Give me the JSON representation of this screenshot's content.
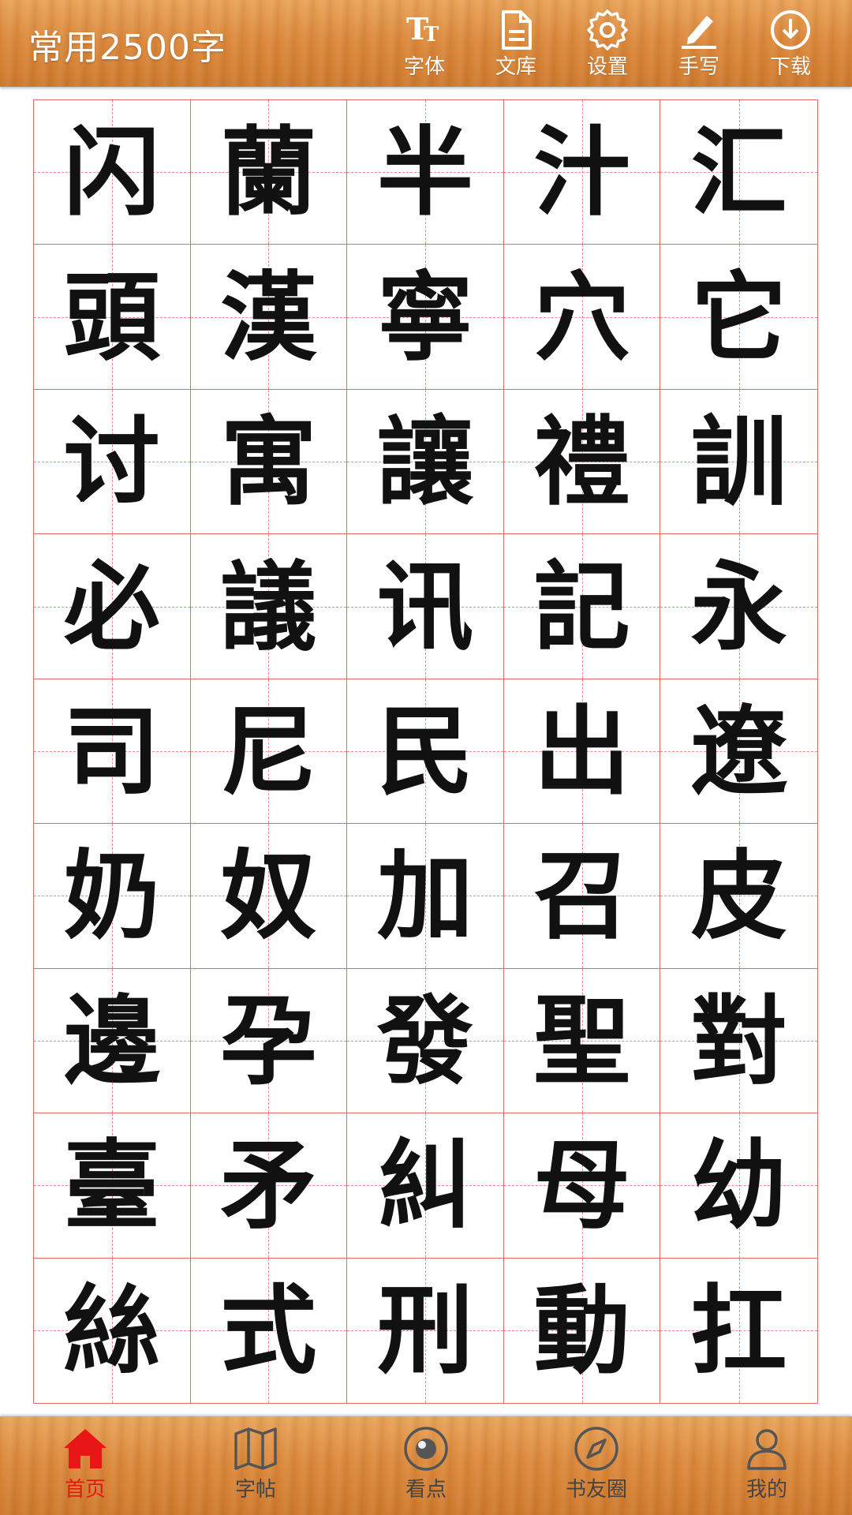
{
  "header": {
    "title": "常用2500字",
    "buttons": [
      {
        "label": "字体",
        "icon": "font-size-icon"
      },
      {
        "label": "文库",
        "icon": "document-icon"
      },
      {
        "label": "设置",
        "icon": "gear-icon"
      },
      {
        "label": "手写",
        "icon": "pen-icon"
      },
      {
        "label": "下载",
        "icon": "download-icon"
      }
    ]
  },
  "grid": {
    "rows": [
      [
        "闪",
        "蘭",
        "半",
        "汁",
        "汇"
      ],
      [
        "頭",
        "漢",
        "寧",
        "穴",
        "它"
      ],
      [
        "讨",
        "寓",
        "讓",
        "禮",
        "訓"
      ],
      [
        "必",
        "議",
        "讯",
        "記",
        "永"
      ],
      [
        "司",
        "尼",
        "民",
        "出",
        "遼"
      ],
      [
        "奶",
        "奴",
        "加",
        "召",
        "皮"
      ],
      [
        "邊",
        "孕",
        "發",
        "聖",
        "對"
      ],
      [
        "臺",
        "矛",
        "糾",
        "母",
        "幼"
      ],
      [
        "絲",
        "式",
        "刑",
        "動",
        "扛"
      ]
    ]
  },
  "bottom_nav": {
    "items": [
      {
        "label": "首页",
        "icon": "home-icon",
        "active": true
      },
      {
        "label": "字帖",
        "icon": "map-book-icon",
        "active": false
      },
      {
        "label": "看点",
        "icon": "eye-icon",
        "active": false
      },
      {
        "label": "书友圈",
        "icon": "compass-icon",
        "active": false
      },
      {
        "label": "我的",
        "icon": "person-icon",
        "active": false
      }
    ]
  },
  "colors": {
    "wood": "#dc8a3d",
    "grid_line": "#e46a6a",
    "active_tab": "#e81616"
  }
}
